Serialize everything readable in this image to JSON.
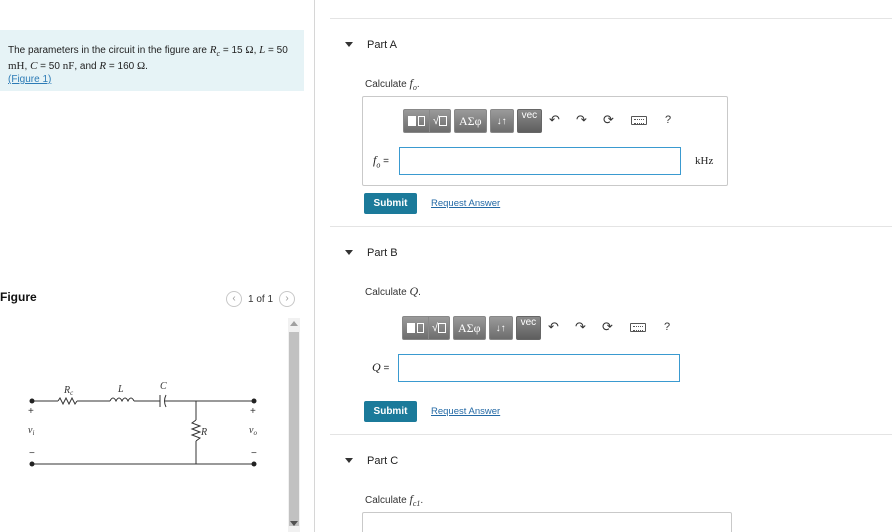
{
  "problem": {
    "text_intro": "The parameters in the circuit in the figure are ",
    "r_sym": "R",
    "r_sub": "c",
    "r_val": " = 15 ",
    "ohm": "Ω",
    "l_sym": "L",
    "l_val": " = 50",
    "line2_mh": "mH",
    "c_sym": "C",
    "c_val": " = 50 ",
    "nf": "nF",
    "and_text": ", and ",
    "r2_sym": "R",
    "r2_val": " = 160 ",
    "period": ".",
    "figure_link": "(Figure 1)"
  },
  "figure": {
    "label": "Figure",
    "pager_text": "1 of 1",
    "prev_icon": "chevron-left",
    "next_icon": "chevron-right",
    "circuit": {
      "rc_label": "R",
      "rc_sub": "c",
      "l_label": "L",
      "c_label": "C",
      "r_label": "R",
      "vi_label": "v",
      "vi_sub": "i",
      "vo_label": "v",
      "vo_sub": "o",
      "plus": "+",
      "minus": "−"
    }
  },
  "parts": [
    {
      "title": "Part A",
      "prompt": "Calculate ",
      "prompt_var": "f",
      "prompt_sub": "o",
      "prompt_end": ".",
      "var_label": "f",
      "var_sub": "o",
      "var_eq": " =",
      "input_value": "",
      "unit": "kHz",
      "submit_label": "Submit",
      "request_label": "Request Answer"
    },
    {
      "title": "Part B",
      "prompt": "Calculate ",
      "prompt_var": "Q",
      "prompt_sub": "",
      "prompt_end": ".",
      "var_label": "Q",
      "var_sub": "",
      "var_eq": " =",
      "input_value": "",
      "unit": "",
      "submit_label": "Submit",
      "request_label": "Request Answer"
    },
    {
      "title": "Part C",
      "prompt": "Calculate ",
      "prompt_var": "f",
      "prompt_sub": "c1",
      "prompt_end": "."
    }
  ],
  "toolbar": {
    "templates_icon": "templates-icon",
    "greek_label": "ΑΣφ",
    "arrows_label": "↓↑",
    "vec_label": "vec",
    "undo_icon": "↶",
    "redo_icon": "↷",
    "reset_icon": "⟳",
    "keyboard_icon": "keyboard-icon",
    "help_label": "?"
  }
}
